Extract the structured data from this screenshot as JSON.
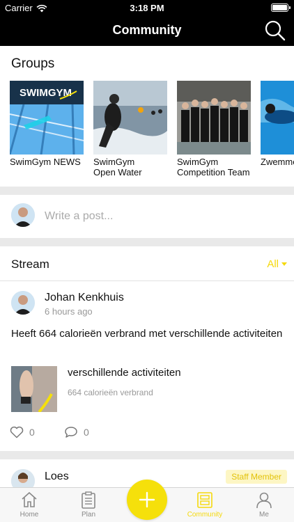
{
  "status_bar": {
    "carrier": "Carrier",
    "time": "3:18 PM"
  },
  "nav": {
    "title": "Community",
    "search_icon": "search-icon"
  },
  "groups": {
    "title": "Groups",
    "items": [
      {
        "label_line1": "SwimGym NEWS",
        "label_line2": "",
        "logo_text": "SWIMGYM"
      },
      {
        "label_line1": "SwimGym",
        "label_line2": "Open Water"
      },
      {
        "label_line1": "SwimGym",
        "label_line2": "Competition Team"
      },
      {
        "label_line1": "Zwemmen",
        "label_line2": ""
      }
    ]
  },
  "composer": {
    "placeholder": "Write a post..."
  },
  "stream": {
    "title": "Stream",
    "filter": "All"
  },
  "post": {
    "author": "Johan Kenkhuis",
    "time": "6 hours ago",
    "text": "Heeft 664 calorieën verbrand met verschillende activiteiten",
    "attachment_title": "verschillende activiteiten",
    "attachment_sub": "664 calorieën verbrand",
    "likes": "0",
    "comments": "0"
  },
  "post2": {
    "author": "Loes",
    "badge": "Staff Member"
  },
  "tabs": [
    {
      "label": "Home",
      "icon": "home-icon"
    },
    {
      "label": "Plan",
      "icon": "clipboard-icon"
    },
    {
      "label": "Community",
      "icon": "community-icon"
    },
    {
      "label": "Me",
      "icon": "person-icon"
    }
  ],
  "colors": {
    "accent": "#f5e00b",
    "accent_text": "#f5d90c",
    "nav_bg": "#000000"
  }
}
